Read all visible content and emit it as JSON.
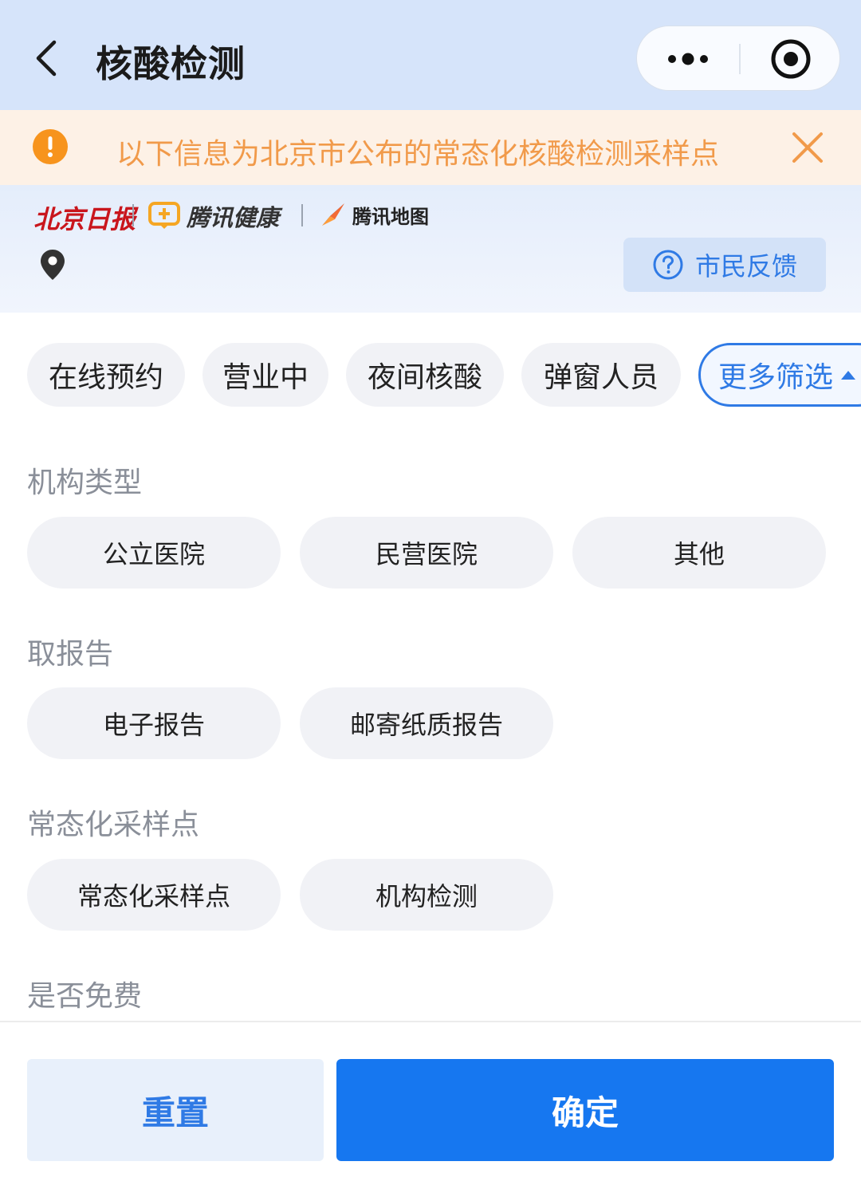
{
  "header": {
    "title": "核酸检测",
    "back_icon": "chevron-left-icon",
    "more_icon": "more-dots-icon",
    "close_icon": "target-circle-icon"
  },
  "notice": {
    "text": "以下信息为北京市公布的常态化核酸检测采样点",
    "icon": "warning-circle-icon",
    "close_icon": "close-icon"
  },
  "banner": {
    "logo_bj": "北京日报",
    "logo_health": "腾讯健康",
    "logo_map": "腾讯地图",
    "location_icon": "location-pin-icon",
    "feedback_label": "市民反馈"
  },
  "quick_filters": [
    "在线预约",
    "营业中",
    "夜间核酸",
    "弹窗人员"
  ],
  "more_filters_label": "更多筛选",
  "sections": {
    "org_type": {
      "title": "机构类型",
      "options": [
        "公立医院",
        "民营医院",
        "其他"
      ]
    },
    "report": {
      "title": "取报告",
      "options": [
        "电子报告",
        "邮寄纸质报告"
      ]
    },
    "sampling": {
      "title": "常态化采样点",
      "options": [
        "常态化采样点",
        "机构检测"
      ]
    },
    "free": {
      "title": "是否免费"
    }
  },
  "footer": {
    "reset_label": "重置",
    "confirm_label": "确定"
  },
  "colors": {
    "accent": "#2f7ae5",
    "primary_button": "#1677f0",
    "notice_text": "#f19a4a",
    "notice_icon": "#f7941d",
    "header_bg": "#d6e4fa",
    "chip_bg": "#f1f2f6"
  }
}
